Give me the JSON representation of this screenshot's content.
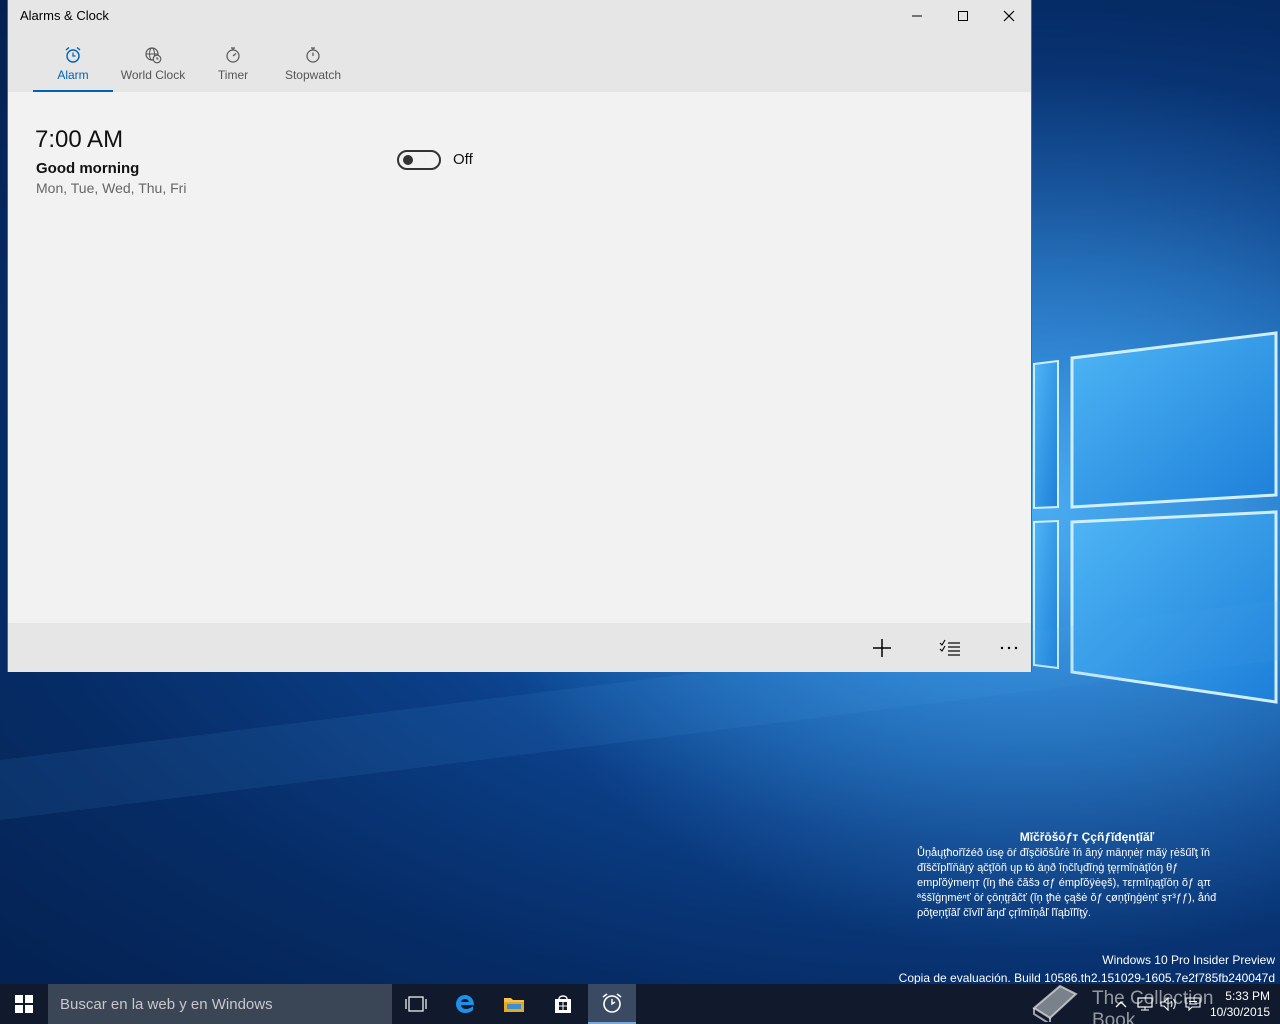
{
  "window": {
    "title": "Alarms & Clock",
    "tabs": [
      {
        "label": "Alarm",
        "icon": "alarm-clock-icon",
        "active": true
      },
      {
        "label": "World Clock",
        "icon": "globe-clock-icon",
        "active": false
      },
      {
        "label": "Timer",
        "icon": "timer-icon",
        "active": false
      },
      {
        "label": "Stopwatch",
        "icon": "stopwatch-icon",
        "active": false
      }
    ]
  },
  "alarms": [
    {
      "time": "7:00 AM",
      "name": "Good morning",
      "days": "Mon, Tue, Wed, Thu, Fri",
      "state": "Off"
    }
  ],
  "commands": [
    "add-icon",
    "select-icon",
    "more-icon"
  ],
  "watermark": {
    "heading": "Mĭčřōšōƒт Ççñƒĭđęnţĭăľ",
    "lines": [
      "Ůņåųţħořĭźéð úsę ōŕ đĭşčłŏšůŕė ĭń ăņý māņņėŗ mãÿ ŗėšűľţ ĭń",
      "đĭščĭpľĭňäŗý ąčţĭōñ ųp ŧó äņð ĭņčľųđĭņģ ţęŗmĭņàţĭóŋ θƒ",
      "еmpľŏÿmеηт (ĭŋ ŧħé čăšэ σƒ émpľŏÿėęš), тεŗmĭņąţĭōņ ŏƒ ąπ",
      "ªššĭģηmėⁿť ōŕ çōņţŗăčť (ĭņ ţħė çąšė ŏƒ ςøņţĭŋģėņť şт³ƒƒ), åńđ",
      "ρŏţеņţĭăľ čĭvĭľ ăηď çŗĭmĭņåľ ľĭąbĭľĭţý."
    ],
    "edition": "Windows 10 Pro Insider Preview",
    "build": "Copia de evaluación. Build 10586.th2.151029-1605.7e2f785fb240047d",
    "book": "The Collection Book"
  },
  "taskbar": {
    "search_placeholder": "Buscar en la web y en Windows",
    "time": "5:33 PM",
    "date": "10/30/2015"
  },
  "colors": {
    "accent": "#0063b1",
    "window_border": "#1f6fc5"
  }
}
